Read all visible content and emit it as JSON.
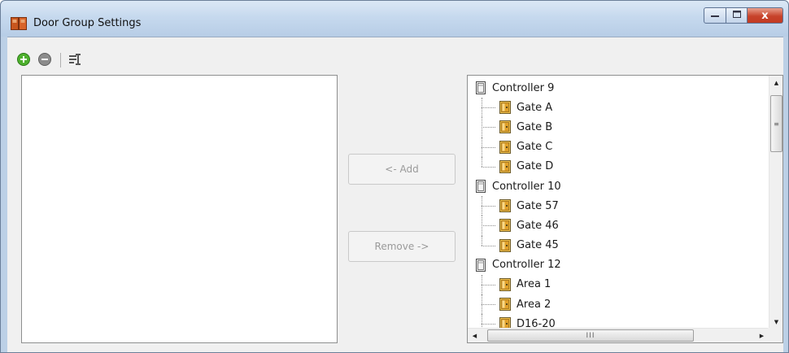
{
  "window": {
    "title": "Door Group Settings",
    "title_icon": "door-group-icon",
    "caption": {
      "minimize_icon": "minimize-icon",
      "maximize_icon": "maximize-icon",
      "close_icon": "close-icon",
      "close_glyph": "x"
    }
  },
  "toolbar": {
    "add_icon": "add-circle-icon",
    "remove_icon": "remove-circle-icon",
    "properties_icon": "properties-icon"
  },
  "buttons": {
    "add_label": "<- Add",
    "remove_label": "Remove ->"
  },
  "tree": {
    "nodes": [
      {
        "type": "controller",
        "label": "Controller 9"
      },
      {
        "type": "door",
        "label": "Gate A"
      },
      {
        "type": "door",
        "label": "Gate B"
      },
      {
        "type": "door",
        "label": "Gate C"
      },
      {
        "type": "door",
        "label": "Gate D",
        "last": true
      },
      {
        "type": "controller",
        "label": "Controller 10"
      },
      {
        "type": "door",
        "label": "Gate 57"
      },
      {
        "type": "door",
        "label": "Gate 46"
      },
      {
        "type": "door",
        "label": "Gate 45",
        "last": true
      },
      {
        "type": "controller",
        "label": "Controller 12"
      },
      {
        "type": "door",
        "label": "Area 1"
      },
      {
        "type": "door",
        "label": "Area 2"
      },
      {
        "type": "door",
        "label": "D16-20"
      }
    ],
    "scroll": {
      "hthumb_glyph": "III",
      "vthumb_glyph": "≡"
    }
  },
  "colors": {
    "close_button": "#c7432b",
    "title_gradient_top": "#dbe8f5",
    "door_icon": "#e0a02a"
  }
}
